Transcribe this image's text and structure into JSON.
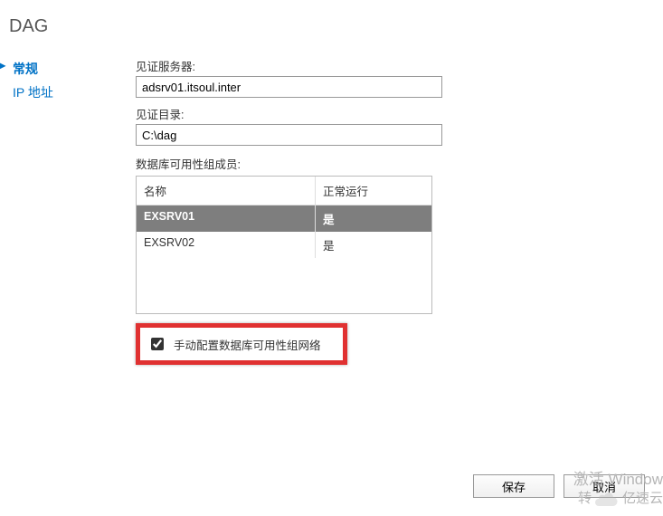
{
  "title": "DAG",
  "sidebar": {
    "items": [
      {
        "label": "常规",
        "active": true
      },
      {
        "label": "IP 地址",
        "active": false
      }
    ]
  },
  "form": {
    "witness_server_label": "见证服务器:",
    "witness_server_value": "adsrv01.itsoul.inter",
    "witness_dir_label": "见证目录:",
    "witness_dir_value": "C:\\dag",
    "members_label": "数据库可用性组成员:",
    "table": {
      "col_name": "名称",
      "col_status": "正常运行",
      "rows": [
        {
          "name": "EXSRV01",
          "status": "是",
          "selected": true
        },
        {
          "name": "EXSRV02",
          "status": "是",
          "selected": false
        }
      ]
    },
    "manual_checkbox": {
      "checked": true,
      "label": "手动配置数据库可用性组网络"
    }
  },
  "footer": {
    "save": "保存",
    "cancel": "取消"
  },
  "watermark": {
    "line1": "激活 Window",
    "line2_prefix": "转",
    "logo_text": "亿速云"
  }
}
